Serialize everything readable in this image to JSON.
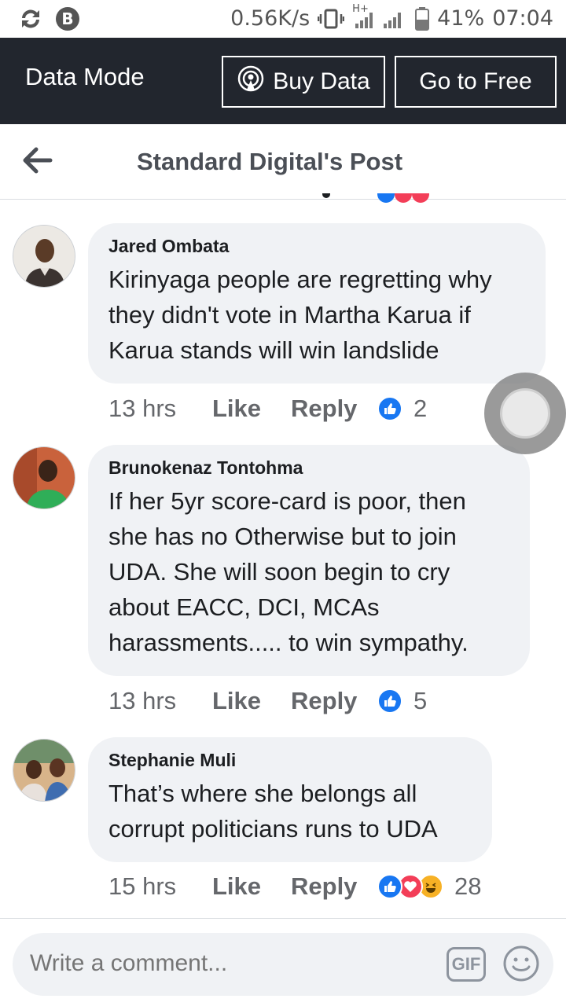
{
  "status_bar": {
    "net_speed": "0.56K/s",
    "network": "H+",
    "battery": "41%",
    "time": "07:04"
  },
  "data_mode": {
    "label": "Data Mode",
    "buy_label": "Buy Data",
    "free_label": "Go to Free"
  },
  "header": {
    "title": "Standard Digital's Post"
  },
  "comments": [
    {
      "author": "Jared Ombata",
      "text": "Kirinyaga people are regretting why they didn't vote in Martha Karua if Karua stands will win landslide",
      "time": "13 hrs",
      "like": "Like",
      "reply": "Reply",
      "reactions": [
        "like"
      ],
      "count": "2"
    },
    {
      "author": "Brunokenaz Tontohma",
      "text": "If her 5yr score-card is poor, then she has no Otherwise but to join UDA. She will soon begin to cry about EACC, DCI, MCAs harassments..... to win sympathy.",
      "time": "13 hrs",
      "like": "Like",
      "reply": "Reply",
      "reactions": [
        "like"
      ],
      "count": "5"
    },
    {
      "author": "Stephanie Muli",
      "text": "That’s where she belongs all corrupt politicians runs to UDA",
      "time": "15 hrs",
      "like": "Like",
      "reply": "Reply",
      "reactions": [
        "like",
        "love",
        "haha"
      ],
      "count": "28"
    }
  ],
  "composer": {
    "placeholder": "Write a comment...",
    "gif_label": "GIF"
  },
  "colors": {
    "like_blue": "#1877f2",
    "love_red": "#f33e58",
    "haha_yellow": "#f7b125",
    "data_bar": "#22262e"
  }
}
